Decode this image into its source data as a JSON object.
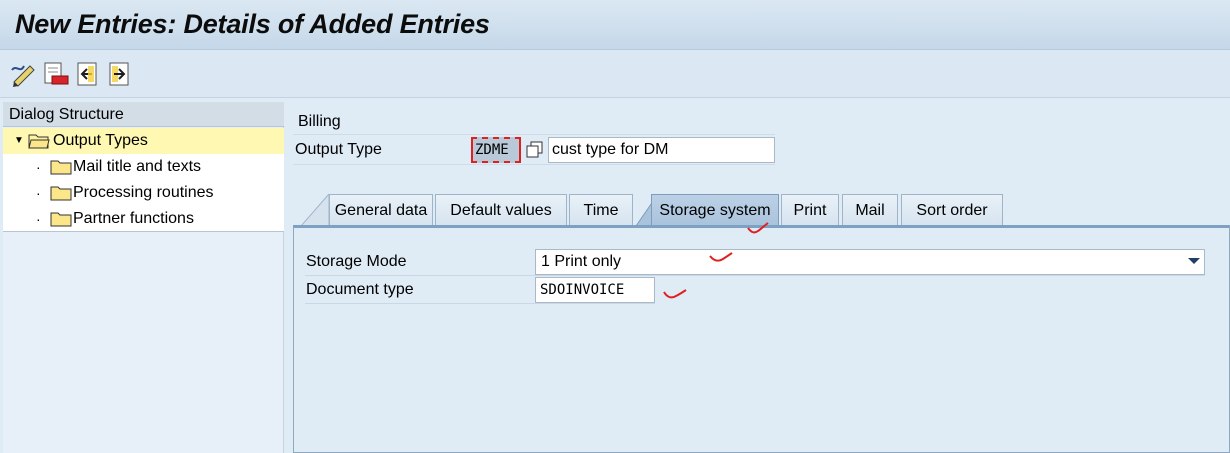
{
  "window": {
    "title": "New Entries: Details of Added Entries"
  },
  "toolbar": {
    "buttons": [
      {
        "name": "pen-icon"
      },
      {
        "name": "delete-entry-icon"
      },
      {
        "name": "previous-entry-icon"
      },
      {
        "name": "next-entry-icon"
      }
    ]
  },
  "dialog_structure": {
    "header": "Dialog Structure",
    "items": [
      {
        "label": "Output Types",
        "selected": true,
        "icon": "open-folder-icon"
      },
      {
        "label": "Mail title and texts",
        "icon": "folder-icon"
      },
      {
        "label": "Processing routines",
        "icon": "folder-icon"
      },
      {
        "label": "Partner functions",
        "icon": "folder-icon"
      }
    ]
  },
  "main": {
    "section_label": "Billing",
    "output_type": {
      "label": "Output Type",
      "code": "ZDME",
      "description": "cust type for DM"
    },
    "tabs": [
      {
        "label": "General data"
      },
      {
        "label": "Default values"
      },
      {
        "label": "Time"
      },
      {
        "label": "Storage system",
        "active": true
      },
      {
        "label": "Print"
      },
      {
        "label": "Mail"
      },
      {
        "label": "Sort order"
      }
    ],
    "storage_mode": {
      "label": "Storage Mode",
      "value": "1 Print only"
    },
    "document_type": {
      "label": "Document type",
      "value": "SDOINVOICE"
    }
  },
  "colors": {
    "background": "#dfebf5",
    "selected_tree_item": "#fff8b3",
    "annotation_red": "#e02020",
    "active_tab": "#a9c3dc"
  }
}
